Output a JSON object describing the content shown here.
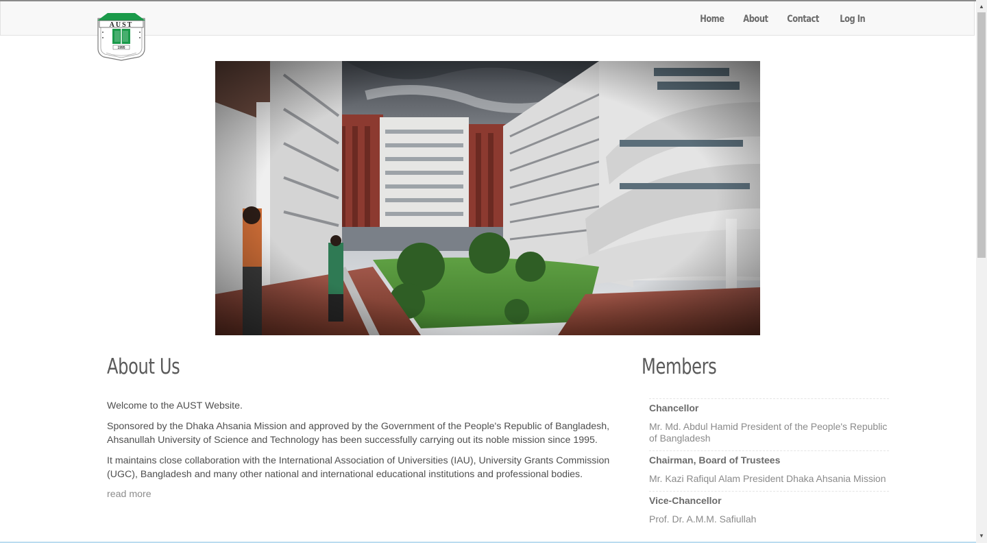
{
  "nav": {
    "logo_text": "AUST",
    "logo_year": "1995",
    "logo_ring": "AHSANULLAH UNIVERSITY OF SCIENCE & TECHNOLOGY",
    "links": [
      "Home",
      "About",
      "Contact",
      "Log In"
    ]
  },
  "about": {
    "title": "About Us",
    "paragraphs": [
      "Welcome to the AUST Website.",
      "Sponsored by the Dhaka Ahsania Mission and approved by the Government of the People's Republic of Bangladesh, Ahsanullah University of Science and Technology has been successfully carrying out its noble mission since 1995.",
      "It maintains close collaboration with the International Association of Universities (IAU), University Grants Commission (UGC), Bangladesh and many other national and international educational institutions and professional bodies."
    ],
    "read_more": "read more"
  },
  "members": {
    "title": "Members",
    "items": [
      {
        "role": "Chancellor",
        "name": "Mr. Md. Abdul Hamid President of the People's Republic of Bangladesh"
      },
      {
        "role": "Chairman, Board of Trustees",
        "name": "Mr. Kazi Rafiqul Alam President Dhaka Ahsania Mission"
      },
      {
        "role": "Vice-Chancellor",
        "name": "Prof. Dr. A.M.M. Safiullah"
      }
    ]
  },
  "colors": {
    "logo_green": "#1a9a4a",
    "nav_bg": "#f8f8f8",
    "heading": "#5a5a5a"
  }
}
